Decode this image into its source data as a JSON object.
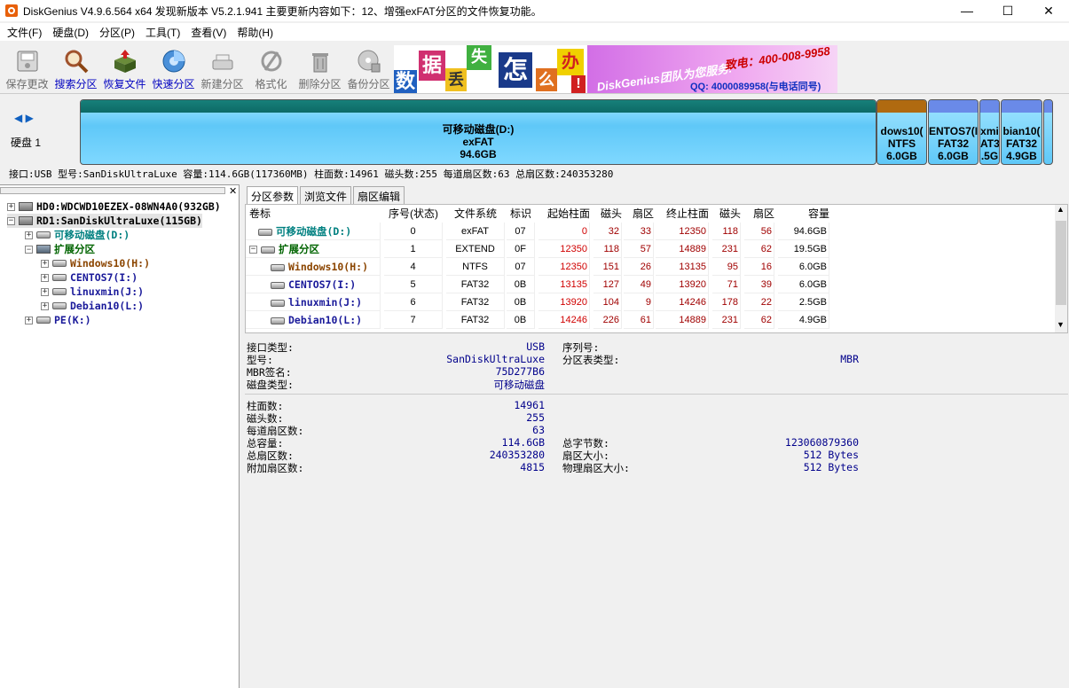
{
  "window": {
    "title": "DiskGenius V4.9.6.564 x64    发现新版本 V5.2.1.941 主要更新内容如下：12、增强exFAT分区的文件恢复功能。",
    "min": "—",
    "max": "☐",
    "close": "✕"
  },
  "menu": [
    "文件(F)",
    "硬盘(D)",
    "分区(P)",
    "工具(T)",
    "查看(V)",
    "帮助(H)"
  ],
  "toolbar": [
    "保存更改",
    "搜索分区",
    "恢复文件",
    "快速分区",
    "新建分区",
    "格式化",
    "删除分区",
    "备份分区"
  ],
  "banner": {
    "chars": [
      "数",
      "据",
      "丢",
      "失",
      "怎",
      "么",
      "办",
      "!"
    ],
    "slogan": "DiskGenius团队为您服务!",
    "phone": "致电：400-008-9958",
    "qq": "QQ: 4000089958(与电话同号)"
  },
  "diskbar": {
    "disk_label": "硬盘 1",
    "main_partition": {
      "name": "可移动磁盘(D:)",
      "fs": "exFAT",
      "size": "94.6GB"
    },
    "small_partitions": [
      {
        "name": "dows10(",
        "fs": "NTFS",
        "size": "6.0GB"
      },
      {
        "name": "ENTOS7(I",
        "fs": "FAT32",
        "size": "6.0GB"
      },
      {
        "name": "xmi",
        "fs": "AT3",
        "size": ".5G"
      },
      {
        "name": "bian10(",
        "fs": "FAT32",
        "size": "4.9GB"
      }
    ],
    "info_line": "接口:USB  型号:SanDiskUltraLuxe  容量:114.6GB(117360MB)  柱面数:14961  磁头数:255  每道扇区数:63  总扇区数:240353280"
  },
  "tree": [
    {
      "label": "HD0:WDCWD10EZEX-08WN4A0(932GB)",
      "color": "#000"
    },
    {
      "label": "RD1:SanDiskUltraLuxe(115GB)",
      "color": "#000"
    },
    {
      "label": "可移动磁盘(D:)",
      "color": "#008080"
    },
    {
      "label": "扩展分区",
      "color": "#006400"
    },
    {
      "label": "Windows10(H:)",
      "color": "#8b4500"
    },
    {
      "label": "CENTOS7(I:)",
      "color": "#1a1a9a"
    },
    {
      "label": "linuxmin(J:)",
      "color": "#1a1a9a"
    },
    {
      "label": "Debian10(L:)",
      "color": "#1a1a9a"
    },
    {
      "label": "PE(K:)",
      "color": "#1a1a9a"
    }
  ],
  "tabs": [
    "分区参数",
    "浏览文件",
    "扇区编辑"
  ],
  "table": {
    "headers": [
      "卷标",
      "序号(状态)",
      "文件系统",
      "标识",
      "起始柱面",
      "磁头",
      "扇区",
      "终止柱面",
      "磁头",
      "扇区",
      "容量"
    ],
    "rows": [
      {
        "label": "可移动磁盘(D:)",
        "color": "#008080",
        "cells": [
          "0",
          "exFAT",
          "07",
          "0",
          "32",
          "33",
          "12350",
          "118",
          "56",
          "94.6GB"
        ]
      },
      {
        "label": "扩展分区",
        "color": "#006400",
        "cells": [
          "1",
          "EXTEND",
          "0F",
          "12350",
          "118",
          "57",
          "14889",
          "231",
          "62",
          "19.5GB"
        ]
      },
      {
        "label": "Windows10(H:)",
        "color": "#8b4500",
        "cells": [
          "4",
          "NTFS",
          "07",
          "12350",
          "151",
          "26",
          "13135",
          "95",
          "16",
          "6.0GB"
        ]
      },
      {
        "label": "CENTOS7(I:)",
        "color": "#1a1a9a",
        "cells": [
          "5",
          "FAT32",
          "0B",
          "13135",
          "127",
          "49",
          "13920",
          "71",
          "39",
          "6.0GB"
        ]
      },
      {
        "label": "linuxmin(J:)",
        "color": "#1a1a9a",
        "cells": [
          "6",
          "FAT32",
          "0B",
          "13920",
          "104",
          "9",
          "14246",
          "178",
          "22",
          "2.5GB"
        ]
      },
      {
        "label": "Debian10(L:)",
        "color": "#1a1a9a",
        "cells": [
          "7",
          "FAT32",
          "0B",
          "14246",
          "226",
          "61",
          "14889",
          "231",
          "62",
          "4.9GB"
        ]
      }
    ]
  },
  "details": {
    "left_top": [
      {
        "k": "接口类型:",
        "v": "USB"
      },
      {
        "k": "型号:",
        "v": "SanDiskUltraLuxe"
      },
      {
        "k": "MBR签名:",
        "v": "75D277B6"
      },
      {
        "k": "磁盘类型:",
        "v": "可移动磁盘"
      }
    ],
    "right_top": [
      {
        "k": "序列号:",
        "v": ""
      },
      {
        "k": "分区表类型:",
        "v": "MBR"
      }
    ],
    "left_bottom": [
      {
        "k": "柱面数:",
        "v": "14961"
      },
      {
        "k": "磁头数:",
        "v": "255"
      },
      {
        "k": "每道扇区数:",
        "v": "63"
      },
      {
        "k": "总容量:",
        "v": "114.6GB"
      },
      {
        "k": "总扇区数:",
        "v": "240353280"
      },
      {
        "k": "附加扇区数:",
        "v": "4815"
      }
    ],
    "right_bottom": [
      {
        "k": "总字节数:",
        "v": "123060879360"
      },
      {
        "k": "扇区大小:",
        "v": "512 Bytes"
      },
      {
        "k": "物理扇区大小:",
        "v": "512 Bytes"
      }
    ]
  }
}
